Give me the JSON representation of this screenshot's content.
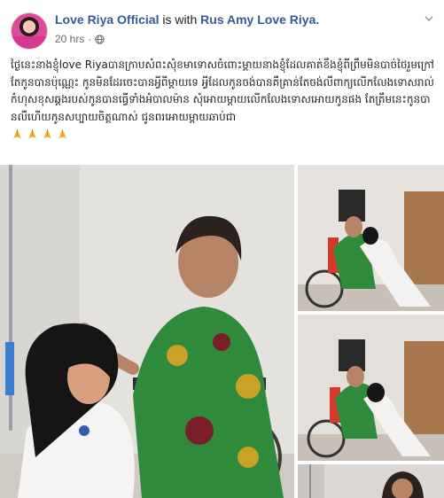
{
  "post": {
    "author": "Love Riya Official",
    "is_with_text": "is with",
    "tagged": "Rus Amy Love Riya.",
    "timestamp": "20 hrs",
    "privacy_icon": "globe-icon",
    "menu_icon": "chevron-down-icon",
    "text": "ថ្ងៃនេះនាងខ្ញុំlove Riyaបានក្រាបសំពះសុំខមាទោសចំពោះម្ដាយនាងខ្ញុំដែលគាត់ខឹងខ្ញុំពីព្រឹមមិនបាច់ថៃរួមក្រៅតែកូនបានប៉ុណ្ណេះ កូនមិនដែរចេះបានអ្វីពីម្ដាយទេ អ្វីដែលកូនចង់បានគឺគ្រាន់តែចង់លឺពាក្យលើកលែងទោសរាល់កំហុសខុសឆ្គងរបស់កូនបានធ្វើទាំងអំបាលម៉ាន សុំអោយម្ដាយលើកលែងទោសអោយកូនផង តែត្រឹមនេះកូនបានលឺហើយកូនសប្បាយចិត្តណាស់ ជូនពរអោយម្ដាយឆាប់ជា",
    "prayer_icon": "folded-hands-icon",
    "prayer_count": 4,
    "photos": [
      {
        "name": "photo-main",
        "description_icon": "photo"
      },
      {
        "name": "photo-right-1",
        "description_icon": "photo"
      },
      {
        "name": "photo-right-2",
        "description_icon": "photo"
      },
      {
        "name": "photo-right-3",
        "description_icon": "photo"
      }
    ]
  },
  "colors": {
    "author_link": "#365899",
    "meta_gray": "#616770",
    "text": "#1c1e21"
  }
}
